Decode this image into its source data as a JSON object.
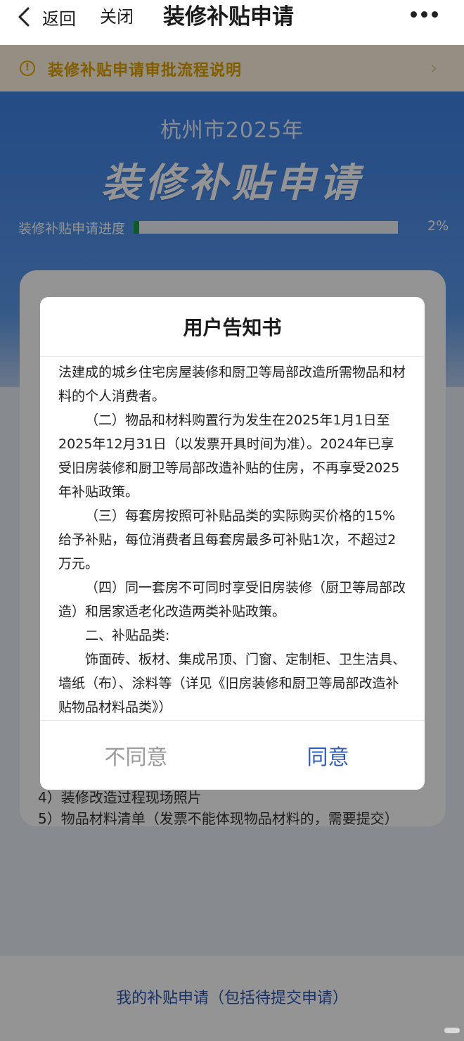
{
  "nav": {
    "back_label": "返回",
    "close_label": "关闭",
    "title": "装修补贴申请"
  },
  "notice": {
    "text": "装修补贴申请审批流程说明"
  },
  "hero": {
    "city_year": "杭州市2025年",
    "title": "装修补贴申请",
    "progress_label": "装修补贴申请进度",
    "progress_value": 0.02,
    "progress_text": "2%"
  },
  "card": {
    "items": [
      "4）装修改造过程现场照片",
      "5）物品材料清单（发票不能体现物品材料的，需要提交）"
    ]
  },
  "dialog": {
    "title": "用户告知书",
    "paragraphs": [
      "法建成的城乡住宅房屋装修和厨卫等局部改造所需物品和材料的个人消费者。",
      "（二）物品和材料购置行为发生在2025年1月1日至2025年12月31日（以发票开具时间为准）。2024年已享受旧房装修和厨卫等局部改造补贴的住房，不再享受2025年补贴政策。",
      "（三）每套房按照可补贴品类的实际购买价格的15%给予补贴，每位消费者且每套房最多可补贴1次，不超过2万元。",
      "（四）同一套房不可同时享受旧房装修（厨卫等局部改造）和居家适老化改造两类补贴政策。",
      "二、补贴品类:",
      "饰面砖、板材、集成吊顶、门窗、定制柜、卫生洁具、墙纸（布）、涂料等（详见《旧房装修和厨卫等局部改造补贴物品材料品类》）"
    ],
    "disagree_label": "不同意",
    "agree_label": "同意"
  },
  "bottom": {
    "link_label": "我的补贴申请（包括待提交申请）"
  },
  "colors": {
    "agree": "#2f5fb8",
    "notice": "#e0a000",
    "progress": "#1a9c4a"
  }
}
